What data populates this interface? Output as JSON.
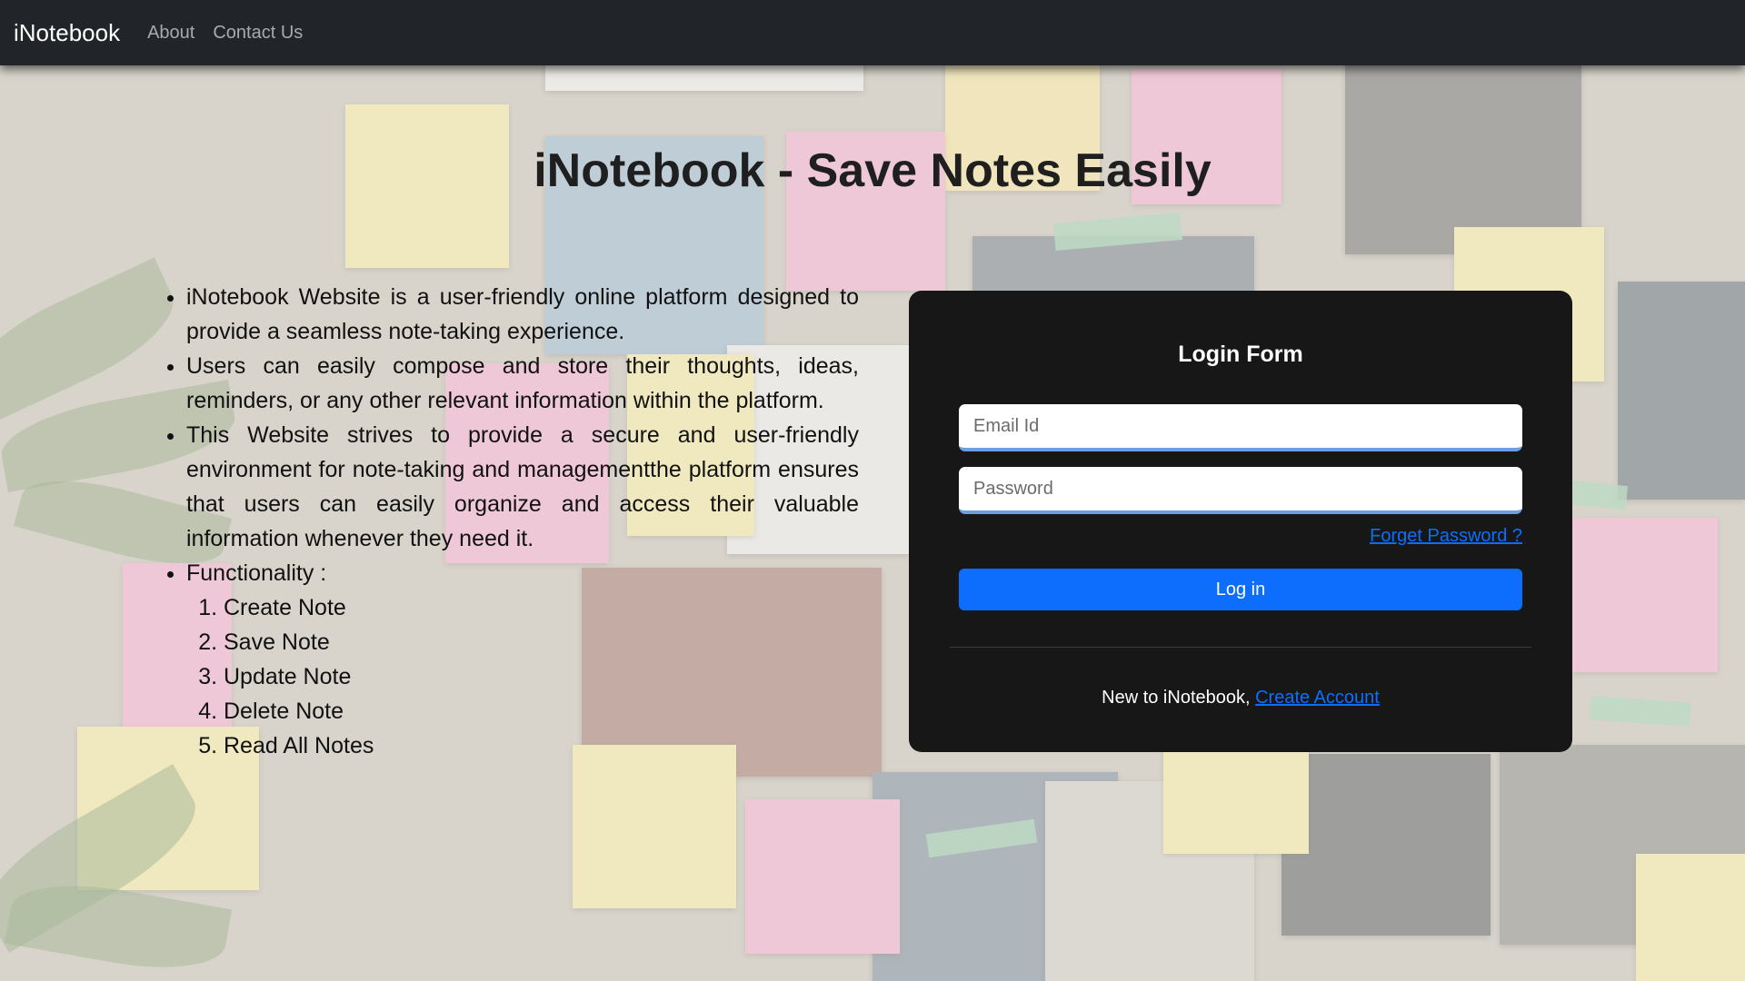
{
  "navbar": {
    "brand": "iNotebook",
    "links": [
      "About",
      "Contact Us"
    ]
  },
  "hero": {
    "title": "iNotebook - Save Notes Easily"
  },
  "info": {
    "bullets": [
      "iNotebook Website is a user-friendly online platform designed to provide a seamless note-taking experience.",
      "Users can easily compose and store their thoughts, ideas, reminders, or any other relevant information within the platform.",
      "This Website strives to provide a secure and user-friendly environment for note-taking and managementthe platform ensures that users can easily organize and access their valuable information whenever they need it.",
      "Functionality :"
    ],
    "functions": [
      "Create Note",
      "Save Note",
      "Update Note",
      "Delete Note",
      "Read All Notes"
    ]
  },
  "login": {
    "title": "Login Form",
    "email_placeholder": "Email Id",
    "password_placeholder": "Password",
    "forget_label": "Forget Password ?",
    "button_label": "Log in",
    "new_text": "New to iNotebook,",
    "create_label": "Create Account"
  },
  "colors": {
    "navbar_bg": "#212529",
    "card_bg": "#171717",
    "accent": "#0d6efd"
  }
}
